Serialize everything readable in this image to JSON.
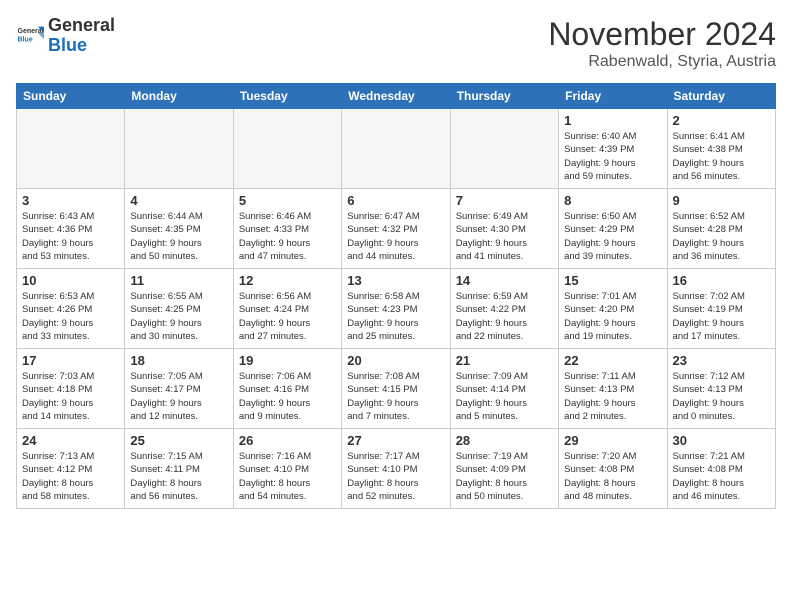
{
  "header": {
    "logo_general": "General",
    "logo_blue": "Blue",
    "month_year": "November 2024",
    "location": "Rabenwald, Styria, Austria"
  },
  "days_of_week": [
    "Sunday",
    "Monday",
    "Tuesday",
    "Wednesday",
    "Thursday",
    "Friday",
    "Saturday"
  ],
  "weeks": [
    [
      {
        "day": "",
        "detail": ""
      },
      {
        "day": "",
        "detail": ""
      },
      {
        "day": "",
        "detail": ""
      },
      {
        "day": "",
        "detail": ""
      },
      {
        "day": "",
        "detail": ""
      },
      {
        "day": "1",
        "detail": "Sunrise: 6:40 AM\nSunset: 4:39 PM\nDaylight: 9 hours\nand 59 minutes."
      },
      {
        "day": "2",
        "detail": "Sunrise: 6:41 AM\nSunset: 4:38 PM\nDaylight: 9 hours\nand 56 minutes."
      }
    ],
    [
      {
        "day": "3",
        "detail": "Sunrise: 6:43 AM\nSunset: 4:36 PM\nDaylight: 9 hours\nand 53 minutes."
      },
      {
        "day": "4",
        "detail": "Sunrise: 6:44 AM\nSunset: 4:35 PM\nDaylight: 9 hours\nand 50 minutes."
      },
      {
        "day": "5",
        "detail": "Sunrise: 6:46 AM\nSunset: 4:33 PM\nDaylight: 9 hours\nand 47 minutes."
      },
      {
        "day": "6",
        "detail": "Sunrise: 6:47 AM\nSunset: 4:32 PM\nDaylight: 9 hours\nand 44 minutes."
      },
      {
        "day": "7",
        "detail": "Sunrise: 6:49 AM\nSunset: 4:30 PM\nDaylight: 9 hours\nand 41 minutes."
      },
      {
        "day": "8",
        "detail": "Sunrise: 6:50 AM\nSunset: 4:29 PM\nDaylight: 9 hours\nand 39 minutes."
      },
      {
        "day": "9",
        "detail": "Sunrise: 6:52 AM\nSunset: 4:28 PM\nDaylight: 9 hours\nand 36 minutes."
      }
    ],
    [
      {
        "day": "10",
        "detail": "Sunrise: 6:53 AM\nSunset: 4:26 PM\nDaylight: 9 hours\nand 33 minutes."
      },
      {
        "day": "11",
        "detail": "Sunrise: 6:55 AM\nSunset: 4:25 PM\nDaylight: 9 hours\nand 30 minutes."
      },
      {
        "day": "12",
        "detail": "Sunrise: 6:56 AM\nSunset: 4:24 PM\nDaylight: 9 hours\nand 27 minutes."
      },
      {
        "day": "13",
        "detail": "Sunrise: 6:58 AM\nSunset: 4:23 PM\nDaylight: 9 hours\nand 25 minutes."
      },
      {
        "day": "14",
        "detail": "Sunrise: 6:59 AM\nSunset: 4:22 PM\nDaylight: 9 hours\nand 22 minutes."
      },
      {
        "day": "15",
        "detail": "Sunrise: 7:01 AM\nSunset: 4:20 PM\nDaylight: 9 hours\nand 19 minutes."
      },
      {
        "day": "16",
        "detail": "Sunrise: 7:02 AM\nSunset: 4:19 PM\nDaylight: 9 hours\nand 17 minutes."
      }
    ],
    [
      {
        "day": "17",
        "detail": "Sunrise: 7:03 AM\nSunset: 4:18 PM\nDaylight: 9 hours\nand 14 minutes."
      },
      {
        "day": "18",
        "detail": "Sunrise: 7:05 AM\nSunset: 4:17 PM\nDaylight: 9 hours\nand 12 minutes."
      },
      {
        "day": "19",
        "detail": "Sunrise: 7:06 AM\nSunset: 4:16 PM\nDaylight: 9 hours\nand 9 minutes."
      },
      {
        "day": "20",
        "detail": "Sunrise: 7:08 AM\nSunset: 4:15 PM\nDaylight: 9 hours\nand 7 minutes."
      },
      {
        "day": "21",
        "detail": "Sunrise: 7:09 AM\nSunset: 4:14 PM\nDaylight: 9 hours\nand 5 minutes."
      },
      {
        "day": "22",
        "detail": "Sunrise: 7:11 AM\nSunset: 4:13 PM\nDaylight: 9 hours\nand 2 minutes."
      },
      {
        "day": "23",
        "detail": "Sunrise: 7:12 AM\nSunset: 4:13 PM\nDaylight: 9 hours\nand 0 minutes."
      }
    ],
    [
      {
        "day": "24",
        "detail": "Sunrise: 7:13 AM\nSunset: 4:12 PM\nDaylight: 8 hours\nand 58 minutes."
      },
      {
        "day": "25",
        "detail": "Sunrise: 7:15 AM\nSunset: 4:11 PM\nDaylight: 8 hours\nand 56 minutes."
      },
      {
        "day": "26",
        "detail": "Sunrise: 7:16 AM\nSunset: 4:10 PM\nDaylight: 8 hours\nand 54 minutes."
      },
      {
        "day": "27",
        "detail": "Sunrise: 7:17 AM\nSunset: 4:10 PM\nDaylight: 8 hours\nand 52 minutes."
      },
      {
        "day": "28",
        "detail": "Sunrise: 7:19 AM\nSunset: 4:09 PM\nDaylight: 8 hours\nand 50 minutes."
      },
      {
        "day": "29",
        "detail": "Sunrise: 7:20 AM\nSunset: 4:08 PM\nDaylight: 8 hours\nand 48 minutes."
      },
      {
        "day": "30",
        "detail": "Sunrise: 7:21 AM\nSunset: 4:08 PM\nDaylight: 8 hours\nand 46 minutes."
      }
    ]
  ]
}
